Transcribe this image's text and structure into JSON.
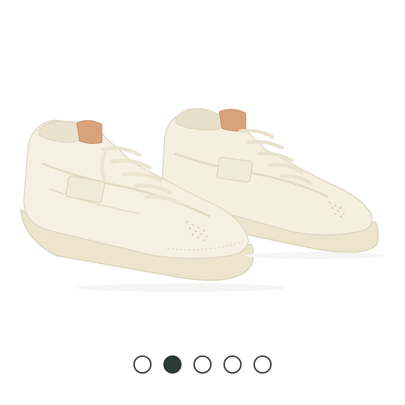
{
  "product": {
    "image_alt": "",
    "colors": {
      "background": "#ffffff",
      "shoe_upper": "#f4efdf",
      "sole": "#ece4cc",
      "cork_heel_tab": "#d9a37a",
      "lace": "#f1ebdb"
    }
  },
  "carousel": {
    "slide_count": 5,
    "active_index": 1,
    "dots": [
      {
        "color": "#ffffff",
        "selected": false
      },
      {
        "color": "#2f3b35",
        "selected": true
      },
      {
        "color": "#ffffff",
        "selected": false
      },
      {
        "color": "#ffffff",
        "selected": false
      },
      {
        "color": "#ffffff",
        "selected": false
      }
    ],
    "border_color": "#2d3330"
  }
}
